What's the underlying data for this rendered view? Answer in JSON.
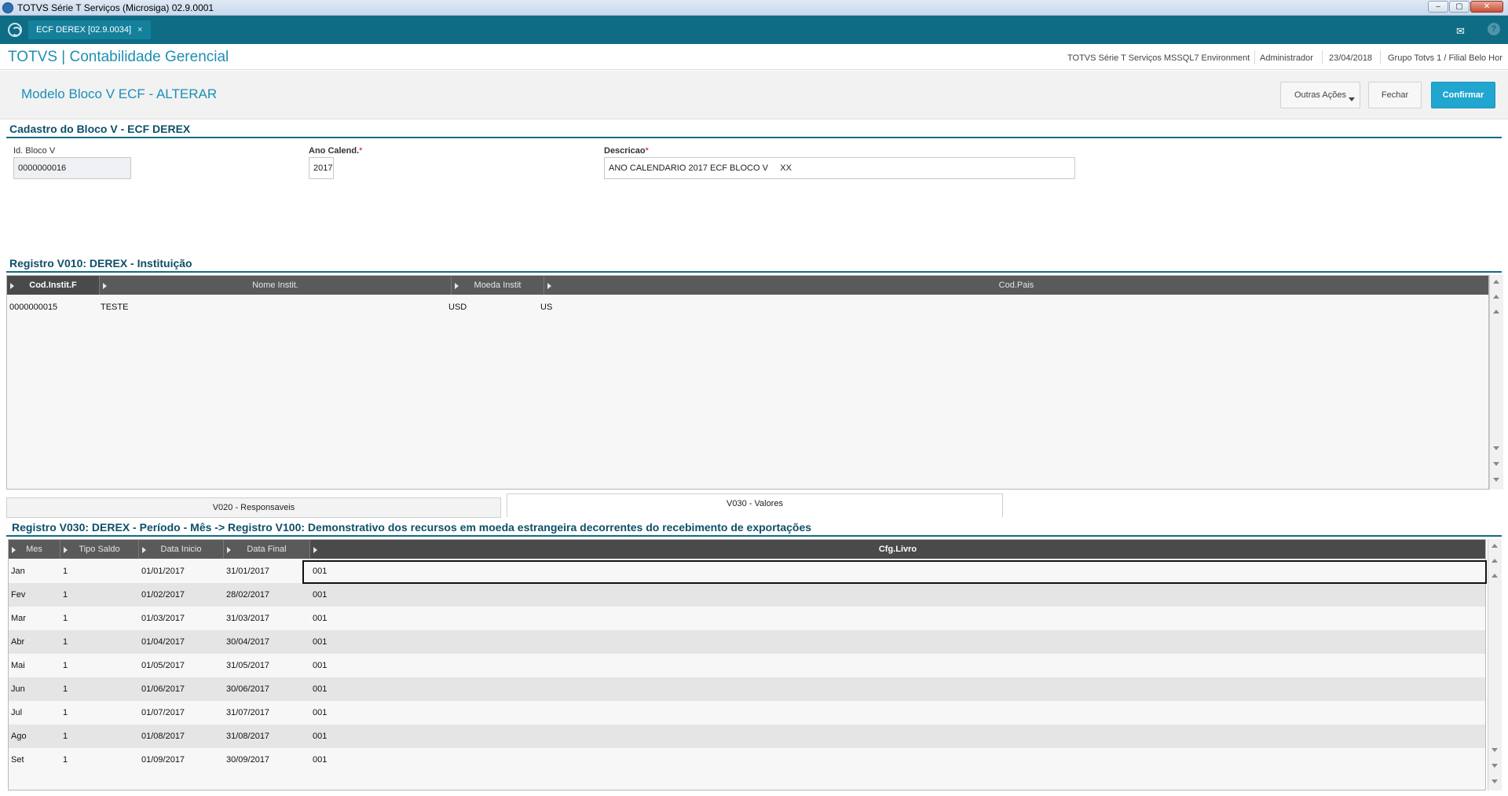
{
  "window": {
    "title": "TOTVS Série T Serviços (Microsiga) 02.9.0001",
    "minimize": "–",
    "maximize": "▢",
    "close": "✕"
  },
  "tabbar": {
    "active_tab": "ECF DEREX [02.9.0034]",
    "close_tab": "×",
    "mail_icon": "✉",
    "help_icon": "?"
  },
  "header": {
    "brand": "TOTVS | Contabilidade Gerencial",
    "environment": "TOTVS Série T Serviços MSSQL7 Environment",
    "user": "Administrador",
    "date": "23/04/2018",
    "branch": "Grupo Totvs 1 / Filial Belo Hor"
  },
  "page": {
    "title": "Modelo Bloco V ECF - ALTERAR",
    "btn_other": "Outras Ações",
    "btn_close": "Fechar",
    "btn_confirm": "Confirmar"
  },
  "form": {
    "section": "Cadastro do Bloco V - ECF DEREX",
    "id_label": "Id. Bloco V",
    "id_value": "0000000016",
    "year_label": "Ano Calend.",
    "year_value": "2017",
    "desc_label": "Descricao",
    "desc_value": "ANO CALENDARIO 2017 ECF BLOCO V     XX",
    "required_mark": "*"
  },
  "v010": {
    "section": "Registro V010: DEREX - Instituição",
    "columns": [
      "Cod.Instit.F",
      "Nome Instit.",
      "Moeda Instit",
      "Cod.Pais"
    ],
    "rows": [
      [
        "0000000015",
        "TESTE",
        "USD",
        "US"
      ]
    ]
  },
  "subtabs": {
    "v020": "V020 - Responsaveis",
    "v030": "V030 - Valores"
  },
  "v030": {
    "section": "Registro V030: DEREX - Período - Mês -> Registro V100: Demonstrativo dos recursos em moeda estrangeira decorrentes do recebimento de exportações",
    "columns": [
      "Mes",
      "Tipo Saldo",
      "Data Inicio",
      "Data Final",
      "Cfg.Livro"
    ],
    "rows": [
      [
        "Jan",
        "1",
        "01/01/2017",
        "31/01/2017",
        "001"
      ],
      [
        "Fev",
        "1",
        "01/02/2017",
        "28/02/2017",
        "001"
      ],
      [
        "Mar",
        "1",
        "01/03/2017",
        "31/03/2017",
        "001"
      ],
      [
        "Abr",
        "1",
        "01/04/2017",
        "30/04/2017",
        "001"
      ],
      [
        "Mai",
        "1",
        "01/05/2017",
        "31/05/2017",
        "001"
      ],
      [
        "Jun",
        "1",
        "01/06/2017",
        "30/06/2017",
        "001"
      ],
      [
        "Jul",
        "1",
        "01/07/2017",
        "31/07/2017",
        "001"
      ],
      [
        "Ago",
        "1",
        "01/08/2017",
        "31/08/2017",
        "001"
      ],
      [
        "Set",
        "1",
        "01/09/2017",
        "30/09/2017",
        "001"
      ]
    ]
  }
}
